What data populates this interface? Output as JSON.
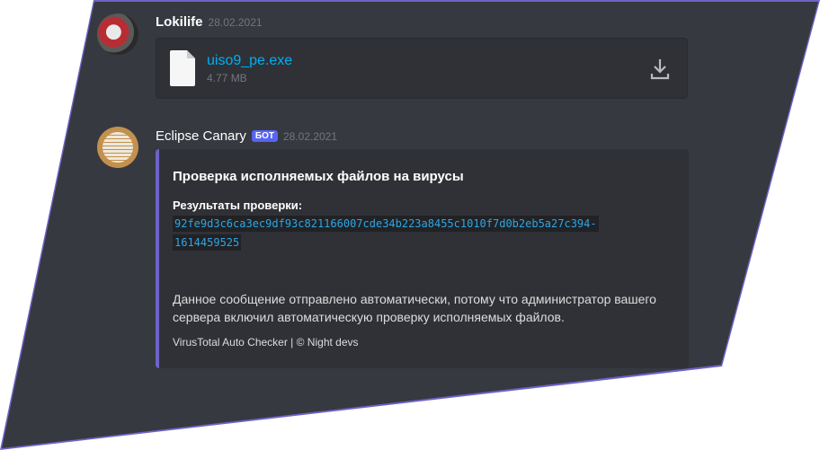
{
  "messages": {
    "user": {
      "author": "Lokilife",
      "timestamp": "28.02.2021",
      "attachment": {
        "file_name": "uiso9_pe.exe",
        "file_size": "4.77 MB"
      }
    },
    "bot": {
      "author": "Eclipse Canary",
      "bot_tag": "БОТ",
      "timestamp": "28.02.2021",
      "embed": {
        "title": "Проверка исполняемых файлов на вирусы",
        "field_name": "Результаты проверки:",
        "hash_line1": "92fe9d3c6ca3ec9df93c821166007cde34b223a8455c1010f7d0b2eb5a27c394-",
        "hash_line2": "1614459525",
        "description": "Данное сообщение отправлено автоматически, потому что администратор вашего сервера включил автоматическую проверку исполняемых файлов.",
        "footer": "VirusTotal Auto Checker | © Night devs"
      }
    }
  },
  "colors": {
    "background": "#36393f",
    "embed_accent": "#6e63c7",
    "link": "#00aff4",
    "bot_tag": "#5865f2"
  }
}
